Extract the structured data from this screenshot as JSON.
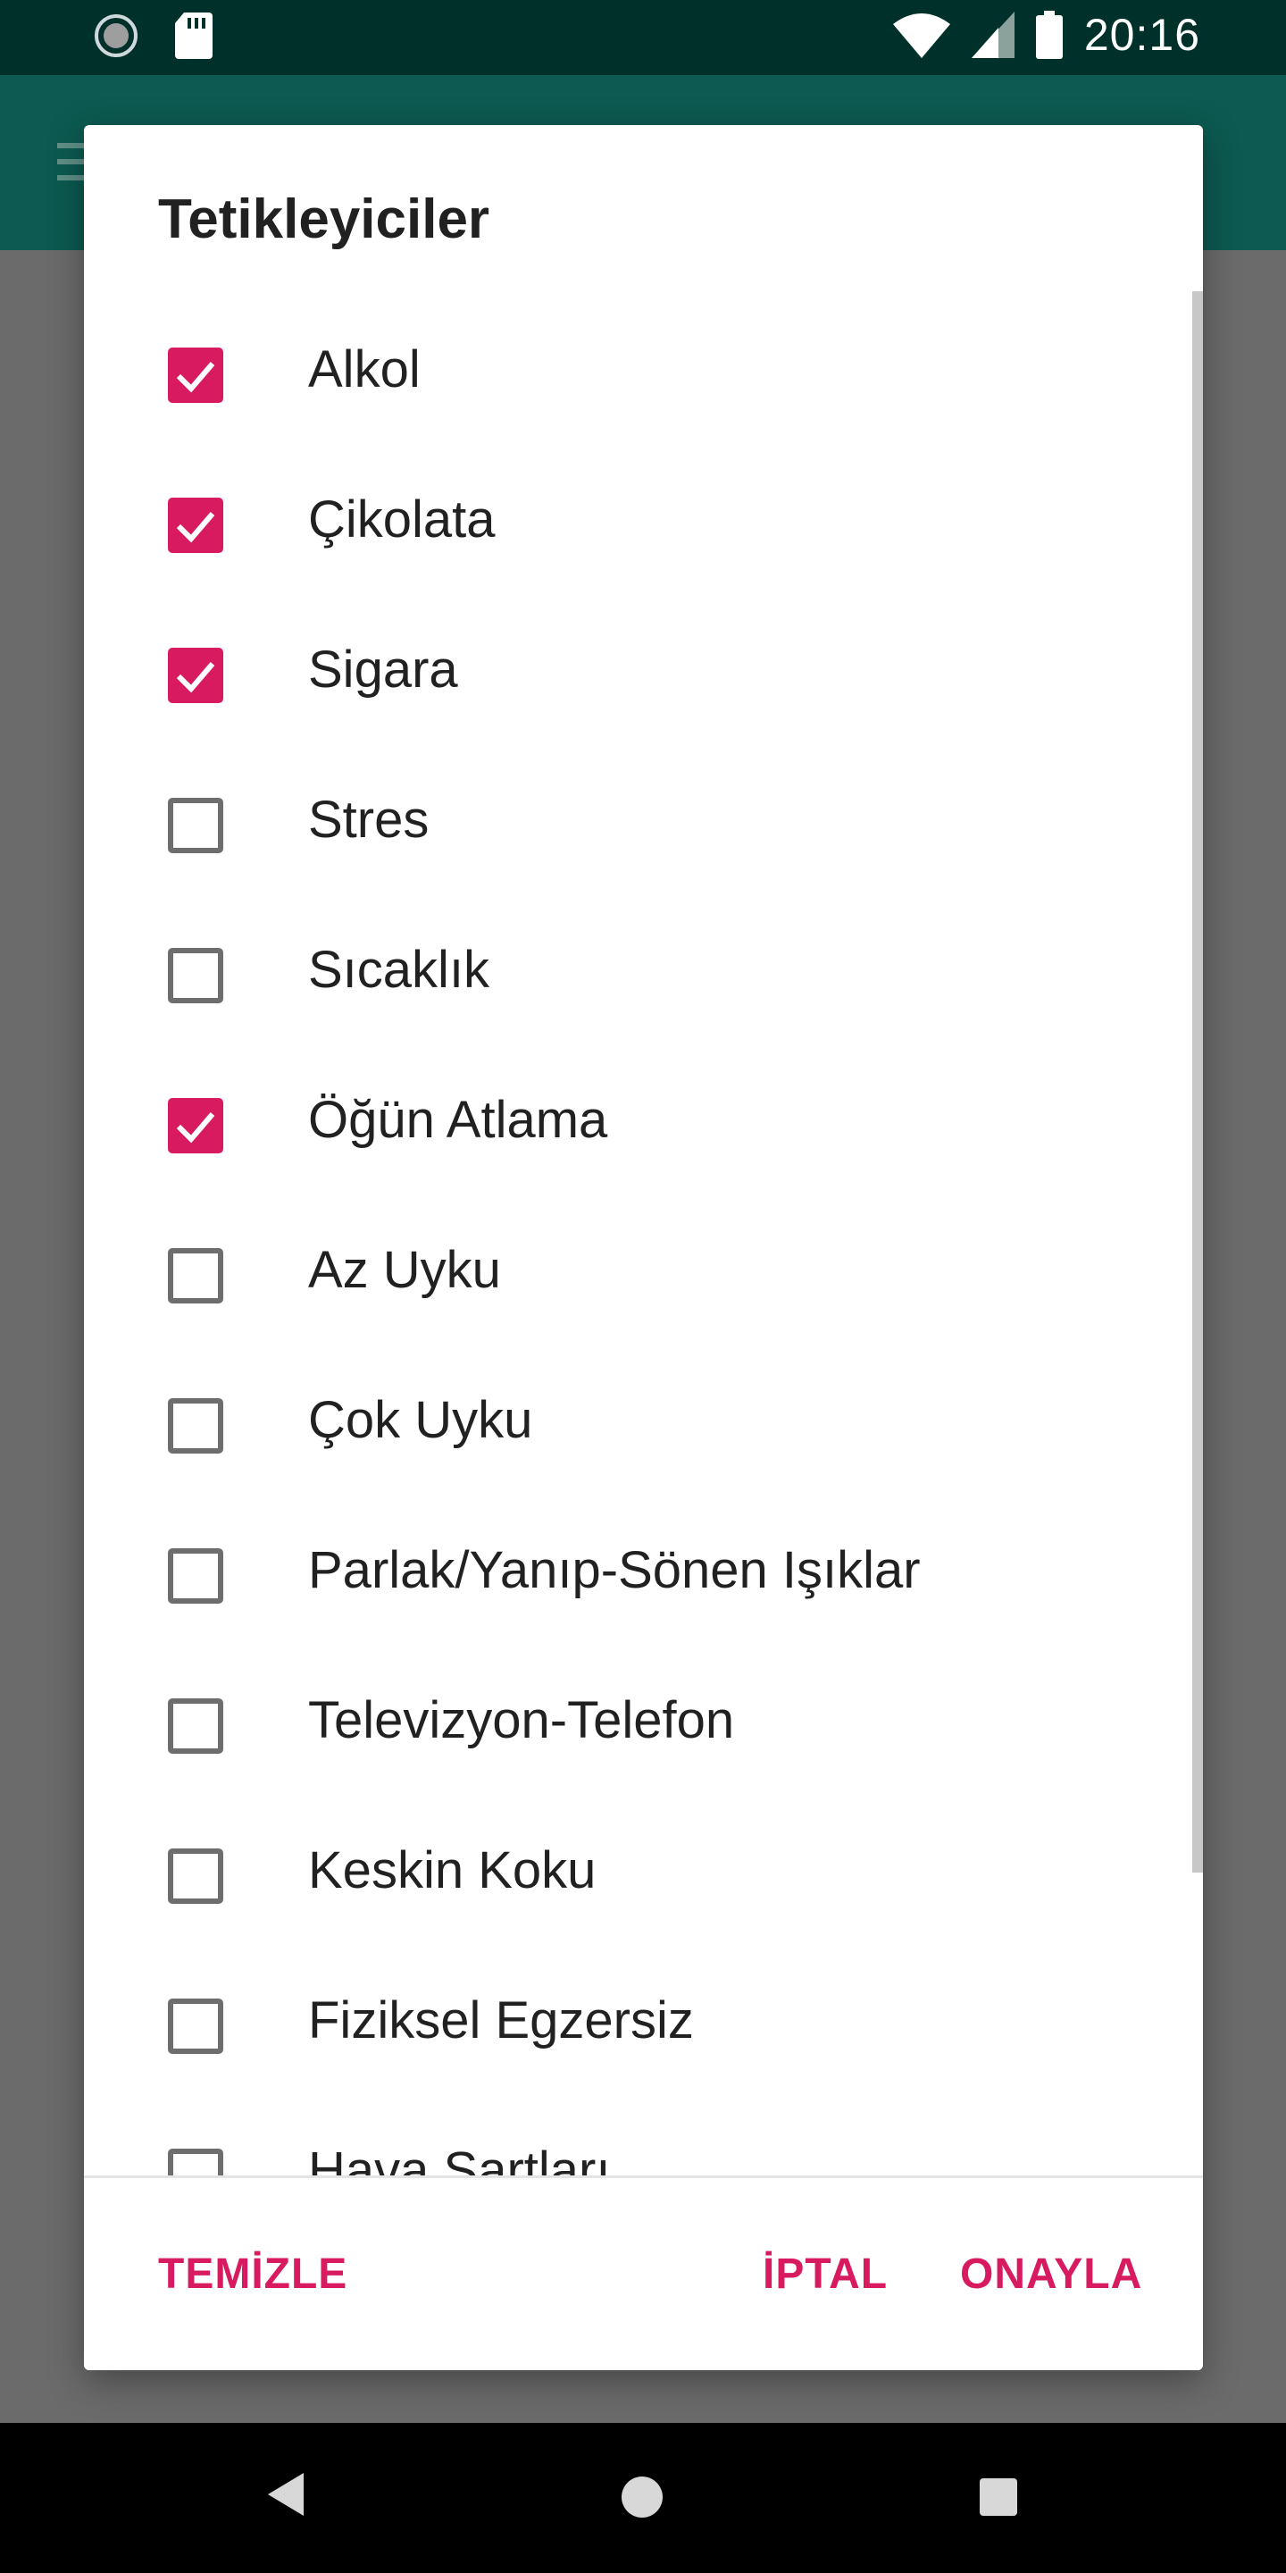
{
  "status_bar": {
    "time": "20:16",
    "icons": [
      "sync-icon",
      "sd-card-icon",
      "wifi-icon",
      "signal-icon",
      "battery-icon"
    ]
  },
  "app_toolbar": {
    "icon": "menu-icon",
    "color": "#0c5a51"
  },
  "dialog": {
    "title": "Tetikleyiciler",
    "items": [
      {
        "label": "Alkol",
        "checked": true
      },
      {
        "label": "Çikolata",
        "checked": true
      },
      {
        "label": "Sigara",
        "checked": true
      },
      {
        "label": "Stres",
        "checked": false
      },
      {
        "label": "Sıcaklık",
        "checked": false
      },
      {
        "label": "Öğün Atlama",
        "checked": true
      },
      {
        "label": "Az Uyku",
        "checked": false
      },
      {
        "label": "Çok Uyku",
        "checked": false
      },
      {
        "label": "Parlak/Yanıp-Sönen Işıklar",
        "checked": false
      },
      {
        "label": "Televizyon-Telefon",
        "checked": false
      },
      {
        "label": "Keskin Koku",
        "checked": false
      },
      {
        "label": "Fiziksel Egzersiz",
        "checked": false
      },
      {
        "label": "Hava Şartları",
        "checked": false
      }
    ],
    "buttons": {
      "clear": "TEMİZLE",
      "cancel": "İPTAL",
      "confirm": "ONAYLA"
    },
    "accent_color": "#d81b60"
  },
  "nav_bar": {
    "icons": [
      "back-icon",
      "home-icon",
      "recents-icon"
    ]
  }
}
